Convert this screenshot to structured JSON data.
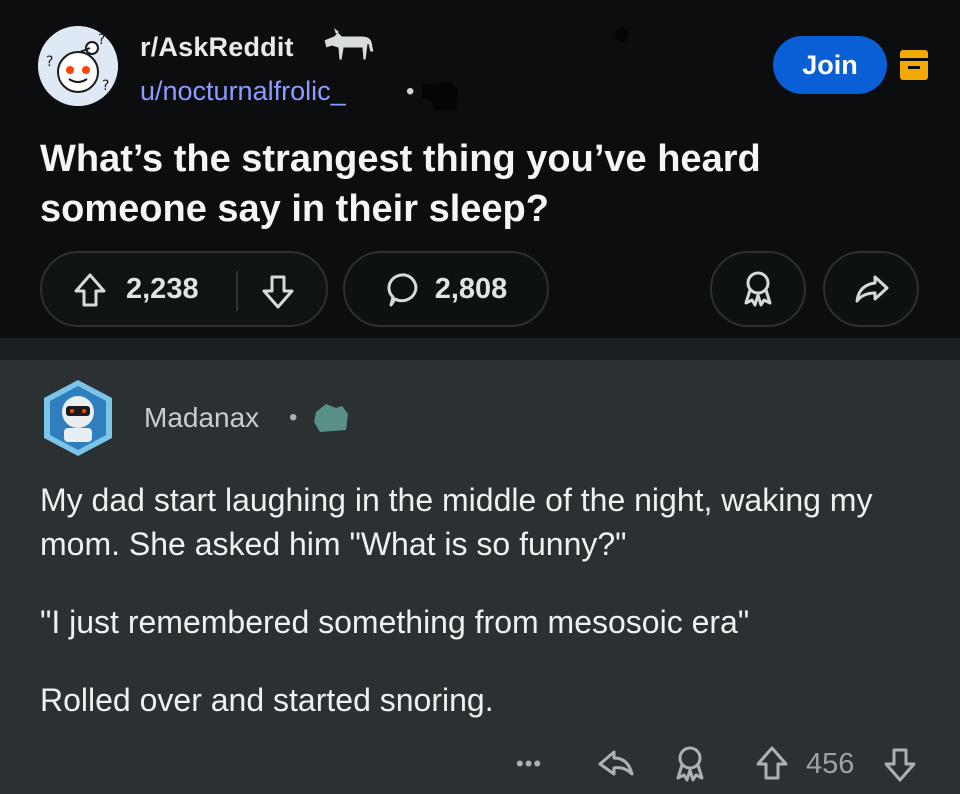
{
  "post": {
    "subreddit": "r/AskReddit",
    "author": "u/nocturnalfrolic_",
    "separator": "•",
    "title": "What’s the strangest thing you’ve heard someone say in their sleep?",
    "join_label": "Join",
    "upvotes": "2,238",
    "comments": "2,808",
    "icons": [
      "upvote-icon",
      "downvote-icon",
      "comment-icon",
      "award-icon",
      "share-icon",
      "archive-icon"
    ],
    "colors": {
      "join": "#0a5fd6",
      "username": "#8f9bff"
    }
  },
  "comment": {
    "author": "Madanax",
    "separator": "•",
    "paragraphs": [
      "My dad start laughing in the middle of the night, waking my mom. She asked him \"What is so funny?\"",
      "\"I just remembered something from mesosoic era\"",
      "Rolled over and started snoring."
    ],
    "more_label": "•••",
    "score": "456",
    "icons": [
      "more-icon",
      "reply-icon",
      "award-icon",
      "upvote-icon",
      "downvote-icon"
    ]
  }
}
